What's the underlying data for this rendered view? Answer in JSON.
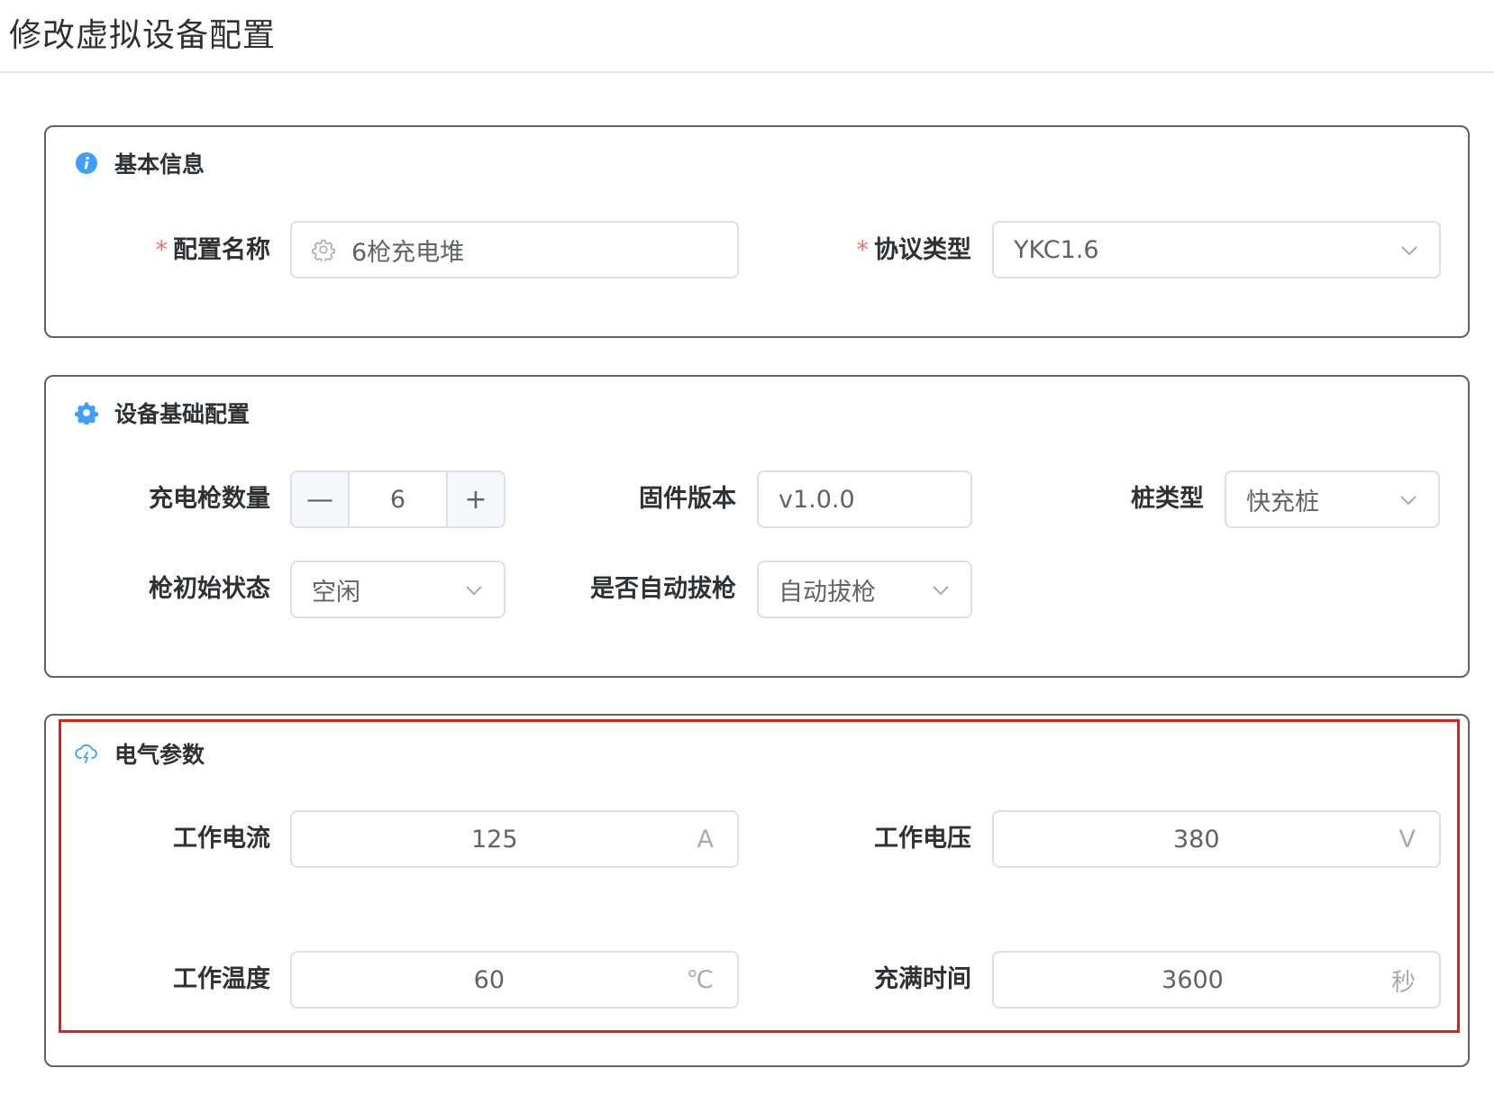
{
  "page": {
    "title": "修改虚拟设备配置"
  },
  "basic_info": {
    "title": "基本信息",
    "icon": "info-icon",
    "config_name": {
      "label": "配置名称",
      "value": "6枪充电堆",
      "required_mark": "*"
    },
    "protocol_type": {
      "label": "协议类型",
      "value": "YKC1.6",
      "required_mark": "*"
    }
  },
  "device_config": {
    "title": "设备基础配置",
    "icon": "gear-icon",
    "gun_count": {
      "label": "充电枪数量",
      "value": "6",
      "minus": "—",
      "plus": "+"
    },
    "firmware_version": {
      "label": "固件版本",
      "value": "v1.0.0"
    },
    "pile_type": {
      "label": "桩类型",
      "value": "快充桩"
    },
    "gun_initial_state": {
      "label": "枪初始状态",
      "value": "空闲"
    },
    "auto_unplug": {
      "label": "是否自动拔枪",
      "value": "自动拔枪"
    }
  },
  "electrical": {
    "title": "电气参数",
    "icon": "cloud-lightning-icon",
    "current": {
      "label": "工作电流",
      "value": "125",
      "unit": "A"
    },
    "voltage": {
      "label": "工作电压",
      "value": "380",
      "unit": "V"
    },
    "temperature": {
      "label": "工作温度",
      "value": "60",
      "unit": "℃"
    },
    "full_time": {
      "label": "充满时间",
      "value": "3600",
      "unit": "秒"
    }
  },
  "colors": {
    "accent": "#409eff",
    "required": "#f56c6c",
    "highlight_box": "#e0201a",
    "border": "#dcdfe6"
  }
}
